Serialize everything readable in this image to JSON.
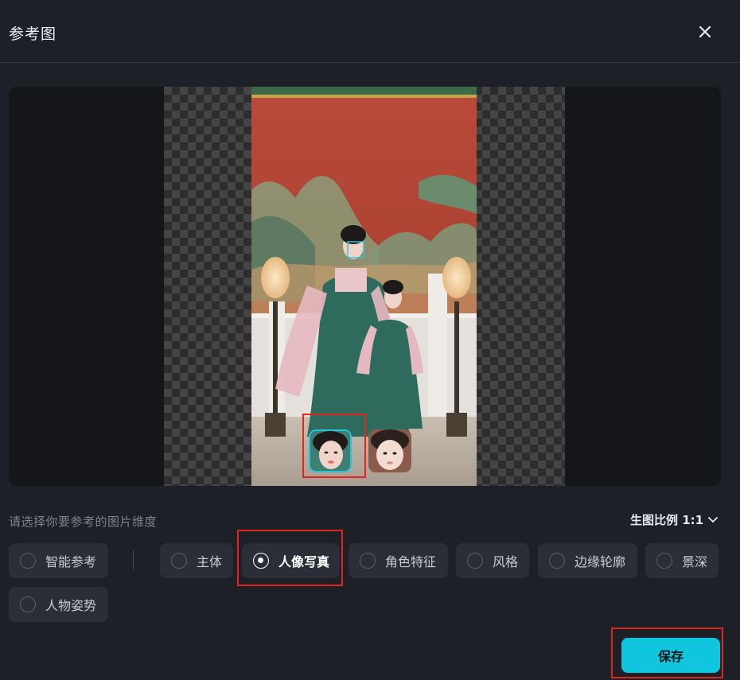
{
  "dialog": {
    "title": "参考图",
    "close_icon": "close-icon"
  },
  "preview": {
    "faces": [
      {
        "name": "woman-face",
        "selected": true
      },
      {
        "name": "girl-face",
        "selected": false
      }
    ]
  },
  "options": {
    "hint": "请选择你要参考的图片维度",
    "ratio_label": "生图比例 1:1",
    "items": [
      {
        "label": "智能参考",
        "selected": false
      },
      {
        "label": "主体",
        "selected": false
      },
      {
        "label": "人像写真",
        "selected": true
      },
      {
        "label": "角色特征",
        "selected": false
      },
      {
        "label": "风格",
        "selected": false
      },
      {
        "label": "边缘轮廓",
        "selected": false
      },
      {
        "label": "景深",
        "selected": false
      },
      {
        "label": "人物姿势",
        "selected": false
      }
    ]
  },
  "footer": {
    "save_label": "保存"
  },
  "colors": {
    "accent": "#0fc6dc",
    "highlight": "#e0261e",
    "background": "#1e2028"
  }
}
